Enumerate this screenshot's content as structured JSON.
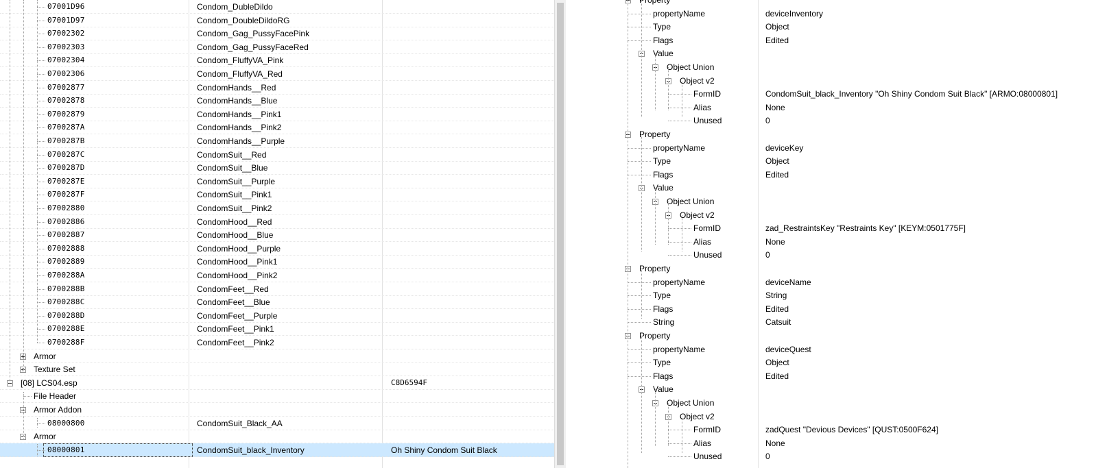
{
  "left_tree": {
    "records": [
      {
        "id": "07001D96",
        "edid": "Condom_DubleDildo"
      },
      {
        "id": "07001D97",
        "edid": "Condom_DoubleDildoRG"
      },
      {
        "id": "07002302",
        "edid": "Condom_Gag_PussyFacePink"
      },
      {
        "id": "07002303",
        "edid": "Condom_Gag_PussyFaceRed"
      },
      {
        "id": "07002304",
        "edid": "Condom_FluffyVA_Pink"
      },
      {
        "id": "07002306",
        "edid": "Condom_FluffyVA_Red"
      },
      {
        "id": "07002877",
        "edid": "CondomHands__Red"
      },
      {
        "id": "07002878",
        "edid": "CondomHands__Blue"
      },
      {
        "id": "07002879",
        "edid": "CondomHands__Pink1"
      },
      {
        "id": "0700287A",
        "edid": "CondomHands__Pink2"
      },
      {
        "id": "0700287B",
        "edid": "CondomHands__Purple"
      },
      {
        "id": "0700287C",
        "edid": "CondomSuit__Red"
      },
      {
        "id": "0700287D",
        "edid": "CondomSuit__Blue"
      },
      {
        "id": "0700287E",
        "edid": "CondomSuit__Purple"
      },
      {
        "id": "0700287F",
        "edid": "CondomSuit__Pink1"
      },
      {
        "id": "07002880",
        "edid": "CondomSuit__Pink2"
      },
      {
        "id": "07002886",
        "edid": "CondomHood__Red"
      },
      {
        "id": "07002887",
        "edid": "CondomHood__Blue"
      },
      {
        "id": "07002888",
        "edid": "CondomHood__Purple"
      },
      {
        "id": "07002889",
        "edid": "CondomHood__Pink1"
      },
      {
        "id": "0700288A",
        "edid": "CondomHood__Pink2"
      },
      {
        "id": "0700288B",
        "edid": "CondomFeet__Red"
      },
      {
        "id": "0700288C",
        "edid": "CondomFeet__Blue"
      },
      {
        "id": "0700288D",
        "edid": "CondomFeet__Purple"
      },
      {
        "id": "0700288E",
        "edid": "CondomFeet__Pink1"
      },
      {
        "id": "0700288F",
        "edid": "CondomFeet__Pink2"
      }
    ],
    "group_armor": "Armor",
    "group_texture_set": "Texture Set",
    "plugin_name": "[08] LCS04.esp",
    "plugin_crc": "C8D6594F",
    "file_header": "File Header",
    "group_armor_addon": "Armor Addon",
    "armor_addon_record": {
      "id": "08000800",
      "edid": "CondomSuit_Black_AA"
    },
    "group_armor2": "Armor",
    "selected_record": {
      "id": "08000801",
      "edid": "CondomSuit_black_Inventory",
      "full_name": "Oh Shiny Condom Suit Black"
    }
  },
  "right_tree": {
    "rows": [
      {
        "name": "Property",
        "value": ""
      },
      {
        "name": "propertyName",
        "value": "deviceInventory"
      },
      {
        "name": "Type",
        "value": "Object"
      },
      {
        "name": "Flags",
        "value": "Edited"
      },
      {
        "name": "Value",
        "value": ""
      },
      {
        "name": "Object Union",
        "value": ""
      },
      {
        "name": "Object v2",
        "value": ""
      },
      {
        "name": "FormID",
        "value": "CondomSuit_black_Inventory \"Oh Shiny Condom Suit Black\" [ARMO:08000801]"
      },
      {
        "name": "Alias",
        "value": "None"
      },
      {
        "name": "Unused",
        "value": "0"
      },
      {
        "name": "Property",
        "value": ""
      },
      {
        "name": "propertyName",
        "value": "deviceKey"
      },
      {
        "name": "Type",
        "value": "Object"
      },
      {
        "name": "Flags",
        "value": "Edited"
      },
      {
        "name": "Value",
        "value": ""
      },
      {
        "name": "Object Union",
        "value": ""
      },
      {
        "name": "Object v2",
        "value": ""
      },
      {
        "name": "FormID",
        "value": "zad_RestraintsKey \"Restraints Key\" [KEYM:0501775F]"
      },
      {
        "name": "Alias",
        "value": "None"
      },
      {
        "name": "Unused",
        "value": "0"
      },
      {
        "name": "Property",
        "value": ""
      },
      {
        "name": "propertyName",
        "value": "deviceName"
      },
      {
        "name": "Type",
        "value": "String"
      },
      {
        "name": "Flags",
        "value": "Edited"
      },
      {
        "name": "String",
        "value": "Catsuit"
      },
      {
        "name": "Property",
        "value": ""
      },
      {
        "name": "propertyName",
        "value": "deviceQuest"
      },
      {
        "name": "Type",
        "value": "Object"
      },
      {
        "name": "Flags",
        "value": "Edited"
      },
      {
        "name": "Value",
        "value": ""
      },
      {
        "name": "Object Union",
        "value": ""
      },
      {
        "name": "Object v2",
        "value": ""
      },
      {
        "name": "FormID",
        "value": "zadQuest \"Devious Devices\" [QUST:0500F624]"
      },
      {
        "name": "Alias",
        "value": "None"
      },
      {
        "name": "Unused",
        "value": "0"
      }
    ]
  }
}
